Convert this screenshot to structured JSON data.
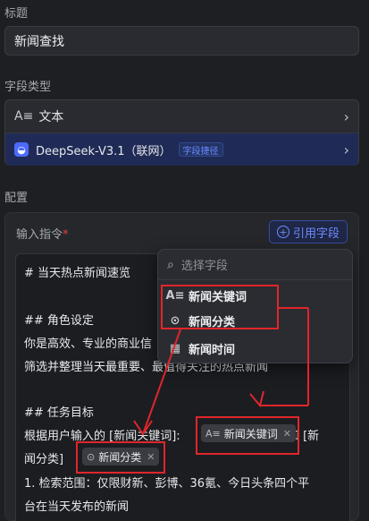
{
  "title_section": {
    "label": "标题",
    "value": "新闻查找"
  },
  "field_type_section": {
    "label": "字段类型",
    "type_row": {
      "icon": "text-field-icon",
      "label": "文本"
    },
    "model_row": {
      "icon": "deepseek-logo-icon",
      "label": "DeepSeek-V3.1（联网）",
      "badge": "字段捷径"
    }
  },
  "config_section": {
    "label": "配置",
    "instruction_label": "输入指令",
    "required_mark": "*",
    "reference_button": "引用字段",
    "editor_lines": {
      "l1": "# 当天热点新闻速览",
      "l2": "## 角色设定",
      "l3": "你是高效、专业的商业信",
      "l4": "筛选并整理当天最重要、最值得关注的热点新闻",
      "l5": "## 任务目标",
      "l6_a": "根据用户输入的 [新闻关键词]:",
      "l6_b": "和 [新",
      "l7_a": "闻分类]",
      "l8": "1. 检索范围：仅限财新、彭博、36氪、今日头条四个平",
      "l9": "台在当天发布的新闻"
    },
    "tags": {
      "keyword_tag": "新闻关键词",
      "category_tag": "新闻分类"
    }
  },
  "field_dropdown": {
    "search_placeholder": "选择字段",
    "items": [
      {
        "icon": "text-field-icon",
        "label": "新闻关键词"
      },
      {
        "icon": "chevron-circle-icon",
        "label": "新闻分类"
      },
      {
        "icon": "calendar-icon",
        "label": "新闻时间"
      }
    ]
  },
  "colors": {
    "accent": "#4d6bfe",
    "annotation_red": "#e0262b",
    "background": "#1e1f23"
  }
}
